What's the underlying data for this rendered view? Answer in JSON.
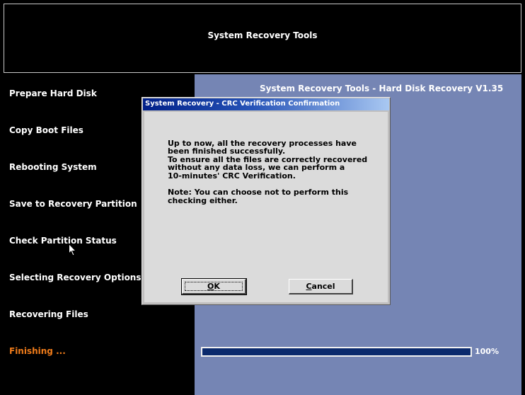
{
  "header": {
    "title": "System Recovery Tools"
  },
  "sidebar": {
    "steps": [
      {
        "label": "Prepare Hard Disk"
      },
      {
        "label": "Copy Boot Files"
      },
      {
        "label": "Rebooting System"
      },
      {
        "label": "Save to Recovery Partition"
      },
      {
        "label": "Check Partition Status"
      },
      {
        "label": "Selecting Recovery Options"
      },
      {
        "label": "Recovering Files"
      },
      {
        "label": "Finishing ..."
      }
    ]
  },
  "main": {
    "title": "System Recovery Tools - Hard Disk Recovery V1.35",
    "progress": {
      "value": 100,
      "label": "100%"
    }
  },
  "dialog": {
    "title": "System Recovery - CRC Verification Confirmation",
    "lines": [
      "Up to now, all the recovery processes have",
      "been finished successfully.",
      "To ensure all the files are correctly recovered",
      "without any data loss, we can perform a",
      "10-minutes' CRC Verification."
    ],
    "note_lines": [
      "Note: You can choose not to perform this",
      "checking either."
    ],
    "ok": {
      "mnemonic": "O",
      "rest": "K"
    },
    "cancel": {
      "mnemonic": "C",
      "rest": "ancel"
    }
  },
  "colors": {
    "active_step": "#f07c1a",
    "main_bg": "#7585b4",
    "progress_fill": "#0b2a6c",
    "titlebar_start": "#001f88",
    "titlebar_end": "#a9c8f2"
  },
  "icons": {
    "cursor": "mouse-pointer-icon"
  }
}
